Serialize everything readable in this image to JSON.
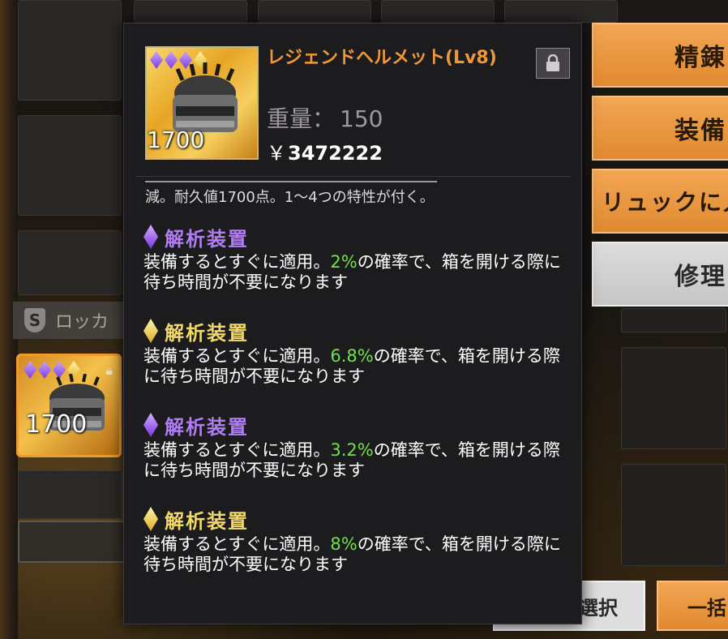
{
  "tooltip": {
    "item": {
      "name": "レジェンドヘルメット(Lv8)",
      "durability_badge": "1700",
      "weight_label": "重量：",
      "weight_value": "150",
      "currency_symbol": "￥",
      "price": "3472222",
      "icon_gems": [
        "purple",
        "purple",
        "purple",
        "gold"
      ]
    },
    "description_cut": "減。耐久値1700点。1～4つの特性が付く。",
    "traits": [
      {
        "tier": "purple",
        "title": "解析装置",
        "text_before": "装備するとすぐに適用。",
        "percent": "2%",
        "text_after": "の確率で、箱を開ける際に待ち時間が不要になります"
      },
      {
        "tier": "gold",
        "title": "解析装置",
        "text_before": "装備するとすぐに適用。",
        "percent": "6.8%",
        "text_after": "の確率で、箱を開ける際に待ち時間が不要になります"
      },
      {
        "tier": "purple",
        "title": "解析装置",
        "text_before": "装備するとすぐに適用。",
        "percent": "3.2%",
        "text_after": "の確率で、箱を開ける際に待ち時間が不要になります"
      },
      {
        "tier": "gold",
        "title": "解析装置",
        "text_before": "装備するとすぐに適用。",
        "percent": "8%",
        "text_after": "の確率で、箱を開ける際に待ち時間が不要になります"
      }
    ]
  },
  "actions": {
    "refine": "精錬",
    "equip": "装備",
    "to_backpack": "リュックに入",
    "repair": "修理"
  },
  "locker": {
    "label": "ロッカ",
    "item_durability": "1700"
  },
  "bottom": {
    "bulk_select": "まとめて選択",
    "bulk": "一括"
  },
  "colors": {
    "accent_orange": "#f0973a",
    "percent_green": "#6fe24a",
    "purple_tier": "#b07df5",
    "gold_tier": "#f2da6a"
  }
}
